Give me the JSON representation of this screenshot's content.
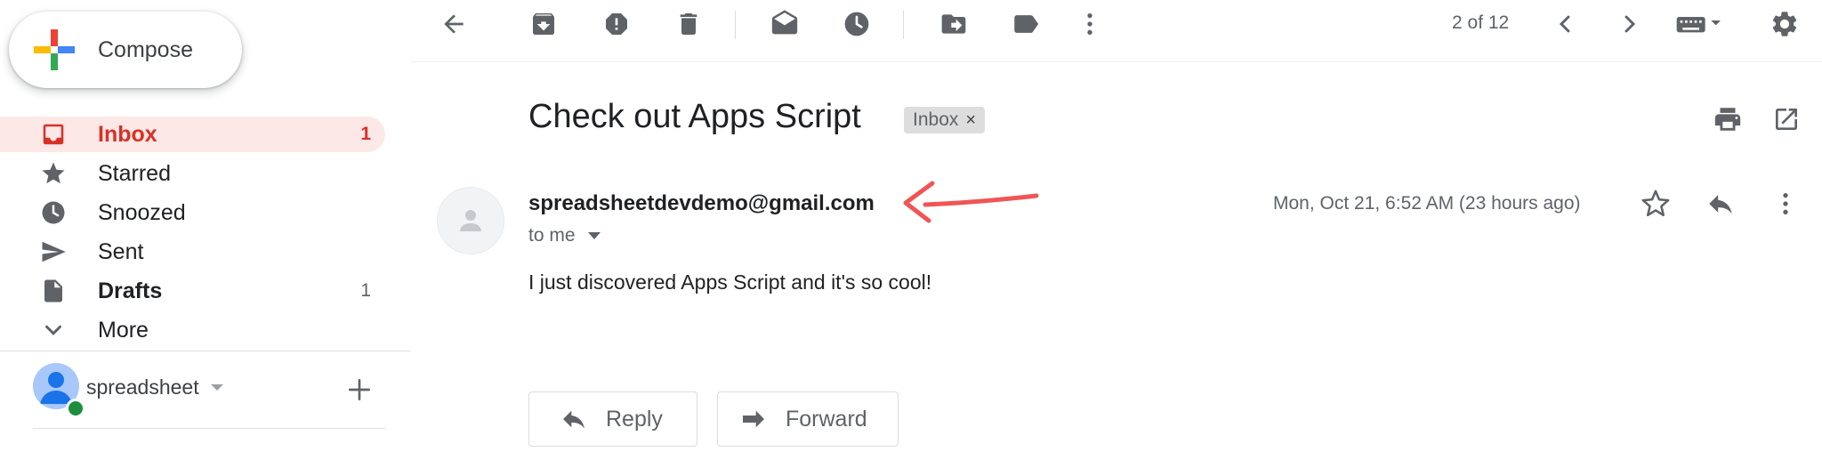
{
  "compose": {
    "label": "Compose"
  },
  "nav": [
    {
      "key": "inbox",
      "label": "Inbox",
      "count": "1"
    },
    {
      "key": "starred",
      "label": "Starred",
      "count": ""
    },
    {
      "key": "snoozed",
      "label": "Snoozed",
      "count": ""
    },
    {
      "key": "sent",
      "label": "Sent",
      "count": ""
    },
    {
      "key": "drafts",
      "label": "Drafts",
      "count": "1"
    },
    {
      "key": "more",
      "label": "More",
      "count": ""
    }
  ],
  "account": {
    "name": "spreadsheet"
  },
  "toolbar": {
    "pager": "2 of 12",
    "icons": [
      "back-arrow-icon",
      "archive-icon",
      "report-spam-icon",
      "delete-icon",
      "mark-unread-icon",
      "snooze-icon",
      "move-to-icon",
      "label-icon",
      "more-vert-icon",
      "chevron-left-icon",
      "chevron-right-icon",
      "keyboard-icon",
      "settings-icon"
    ]
  },
  "message": {
    "subject": "Check out Apps Script",
    "label": "Inbox",
    "label_remove": "×",
    "sender": "spreadsheetdevdemo@gmail.com",
    "recipient": "to me",
    "date": "Mon, Oct 21, 6:52 AM (23 hours ago)",
    "body": "I just discovered Apps Script and it's so cool!"
  },
  "actions": {
    "reply": "Reply",
    "forward": "Forward"
  },
  "colors": {
    "accent_red": "#d93025",
    "active_bg": "#fce8e6",
    "icon_gray": "#5f6368",
    "annotation_arrow": "#f05555"
  }
}
